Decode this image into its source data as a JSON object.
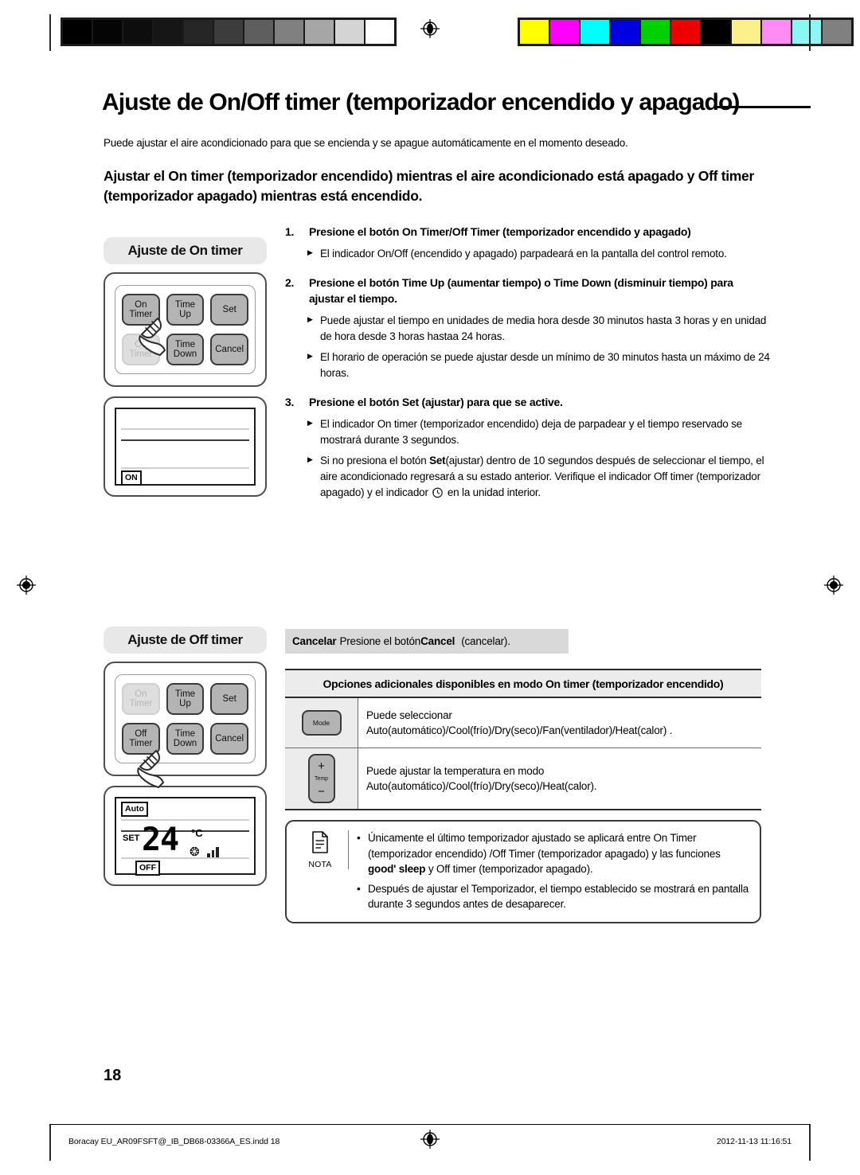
{
  "document": {
    "title": "Ajuste de On/Off timer (temporizador encendido y apagado)",
    "intro": "Puede ajustar el aire acondicionado para que se encienda y se apague automáticamente en el momento deseado.",
    "section_heading": "Ajustar el On timer (temporizador encendido) mientras el aire acondicionado está apagado y Off timer (temporizador apagado) mientras está encendido.",
    "page_number": "18"
  },
  "steps": [
    {
      "number": "1.",
      "title": "Presione el botón On Timer/Off Timer (temporizador encendido y apagado)",
      "bullets": [
        "El indicador On/Off (encendido y apagado) parpadeará en la pantalla del control remoto."
      ]
    },
    {
      "number": "2.",
      "title": "Presione el botón Time Up (aumentar tiempo) o Time Down (disminuir tiempo) para ajustar el tiempo.",
      "bullets": [
        "Puede ajustar el tiempo en unidades de media hora desde 30 minutos hasta 3 horas y en unidad de hora desde 3 horas hastaa 24 horas.",
        "El horario de operación se puede ajustar desde un mínimo de 30 minutos hasta un máximo de 24 horas."
      ]
    },
    {
      "number": "3.",
      "title": "Presione el botón Set (ajustar) para que se active.",
      "bullets": [
        "El indicador On timer (temporizador encendido) deja de parpadear y el tiempo reservado se mostrará durante 3 segundos."
      ]
    }
  ],
  "step3_last_bullet": {
    "part1": "Si no presiona el botón ",
    "bold": "Set",
    "part2": "(ajustar) dentro de 10 segundos después de seleccionar el tiempo, el aire acondicionado regresará a su estado anterior. Verifique el indicador Off timer (temporizador apagado) y el indicador ",
    "icon": "clock-icon",
    "part3": " en la unidad interior."
  },
  "panels": {
    "on_timer": {
      "label": "Ajuste de On timer",
      "buttons": [
        {
          "label": "On\nTimer",
          "state": "active",
          "pressed": true
        },
        {
          "label": "Time\nUp",
          "state": "active",
          "pressed": false
        },
        {
          "label": "Set",
          "state": "active",
          "pressed": false
        },
        {
          "label": "Off\nTimer",
          "state": "dimmed",
          "pressed": false
        },
        {
          "label": "Time\nDown",
          "state": "active",
          "pressed": false
        },
        {
          "label": "Cancel",
          "state": "active",
          "pressed": false
        }
      ],
      "lcd": {
        "mode_tag": "",
        "set_label": "",
        "temperature": "",
        "unit": "",
        "status_tag": "ON"
      }
    },
    "off_timer": {
      "label": "Ajuste de Off timer",
      "buttons": [
        {
          "label": "On\nTimer",
          "state": "dimmed",
          "pressed": false
        },
        {
          "label": "Time\nUp",
          "state": "active",
          "pressed": false
        },
        {
          "label": "Set",
          "state": "active",
          "pressed": false
        },
        {
          "label": "Off\nTimer",
          "state": "active",
          "pressed": true
        },
        {
          "label": "Time\nDown",
          "state": "active",
          "pressed": false
        },
        {
          "label": "Cancel",
          "state": "active",
          "pressed": false
        }
      ],
      "lcd": {
        "mode_tag": "Auto",
        "set_label": "SET",
        "temperature": "24",
        "unit": "°C",
        "status_tag": "OFF"
      }
    }
  },
  "cancel_strip": {
    "label": "Cancelar",
    "text_before": "Presione el botón ",
    "button": "Cancel",
    "text_after": "(cancelar)."
  },
  "options_table": {
    "header": "Opciones adicionales disponibles en modo On timer (temporizador encendido)",
    "rows": [
      {
        "icon": "mode-button-icon",
        "icon_label": "Mode",
        "text": "Puede seleccionar Auto(automático)/Cool(frío)/Dry(seco)/Fan(ventilador)/Heat(calor) ."
      },
      {
        "icon": "temp-button-icon",
        "icon_label": "Temp",
        "icon_plus": "+",
        "icon_minus": "−",
        "text": "Puede ajustar la temperatura en modo Auto(automático)/Cool(frío)/Dry(seco)/Heat(calor)."
      }
    ]
  },
  "note": {
    "label": "NOTA",
    "icon": "document-note-icon",
    "items": [
      {
        "part1": "Únicamente el último temporizador ajustado se aplicará entre On Timer (temporizador encendido) /Off Timer (temporizador apagado) y las funciones ",
        "bold": "good' sleep",
        "part2": " y Off timer (temporizador apagado)."
      },
      {
        "part1": "Después de ajustar el Temporizador, el tiempo establecido se mostrará en pantalla durante 3 segundos antes de desaparecer.",
        "bold": "",
        "part2": ""
      }
    ]
  },
  "footer": {
    "file": "Boracay EU_AR09FSFT@_IB_DB68-03366A_ES.indd   18",
    "date": "2012-11-13   11:16:51"
  },
  "calibration": {
    "grayscale": [
      "#000000",
      "#050505",
      "#0d0d0d",
      "#161616",
      "#262626",
      "#3c3c3c",
      "#5e5e5e",
      "#808080",
      "#a6a6a6",
      "#d4d4d4",
      "#ffffff"
    ],
    "color": [
      "#ffff00",
      "#ff00ff",
      "#00ffff",
      "#0000e0",
      "#00d000",
      "#ee0000",
      "#000000",
      "#fbf08a",
      "#ff8cf0",
      "#8cf5f5",
      "#808080"
    ]
  }
}
